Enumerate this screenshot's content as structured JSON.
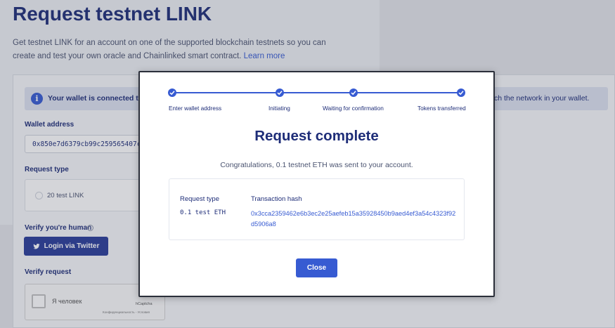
{
  "page": {
    "title": "Request testnet LINK",
    "description": "Get testnet LINK for an account on one of the supported blockchain testnets so you can create and test your own oracle and Chainlinked smart contract.",
    "learn_more": "Learn more",
    "wallet_banner": "Your wallet is connected to Et",
    "wallet_banner_right": "ch the network in your wallet.",
    "wallet_label": "Wallet address",
    "wallet_value": "0x850e7d6379cb99c259565407c9a",
    "request_type_label": "Request type",
    "request_option": "20 test LINK",
    "verify_human_label": "Verify you're human",
    "twitter_button": "Login via Twitter",
    "verify_request_label": "Verify request",
    "captcha_label": "Я человек",
    "captcha_brand": "hCaptcha",
    "captcha_footer": "Конфиденциальность - Условия"
  },
  "modal": {
    "steps": [
      {
        "label": "Enter wallet address",
        "complete": true
      },
      {
        "label": "Initiating",
        "complete": true
      },
      {
        "label": "Waiting for confirmation",
        "complete": true
      },
      {
        "label": "Tokens transferred",
        "complete": true
      }
    ],
    "title": "Request complete",
    "message": "Congratulations, 0.1 testnet ETH was sent to your account.",
    "request_type_header": "Request type",
    "request_type_value": "0.1 test ETH",
    "tx_hash_header": "Transaction hash",
    "tx_hash_value": "0x3cca2359462e6b3ec2e25aefeb15a35928450b9aed4ef3a54c4323f92d5906a8",
    "close_button": "Close"
  },
  "colors": {
    "accent": "#375bd2",
    "heading": "#1e2d78"
  }
}
